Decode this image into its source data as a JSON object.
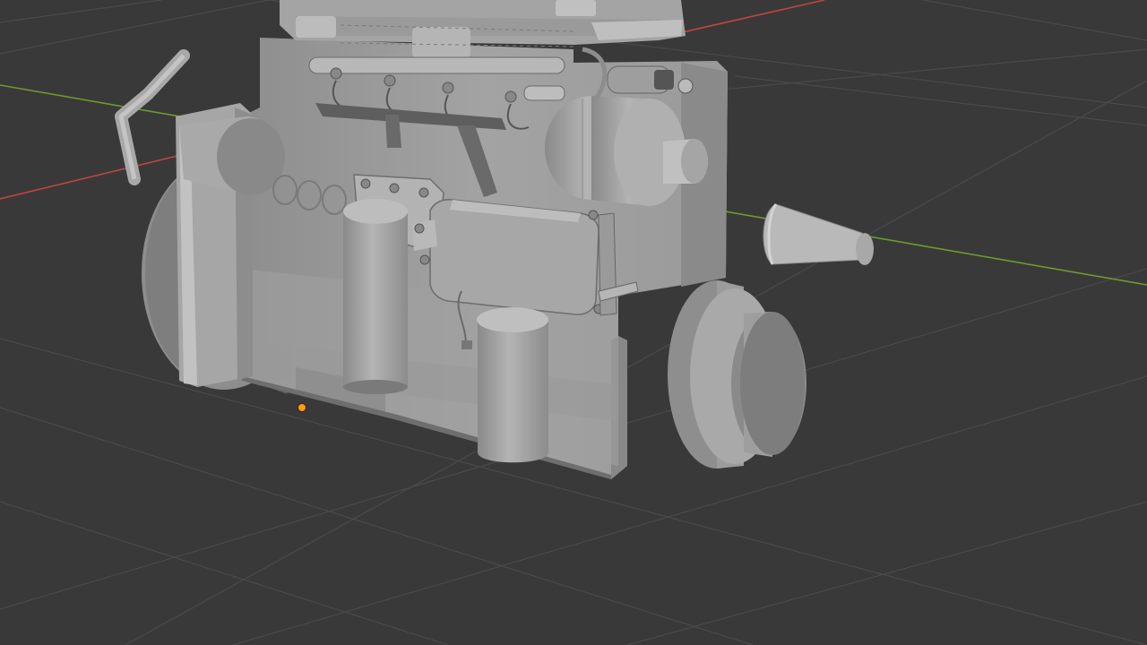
{
  "viewport": {
    "editor": "3D Viewport",
    "shading": "solid",
    "scene_object": "engine-model",
    "axes": {
      "x_axis_color": "#c0453f",
      "y_axis_color": "#6f9a2e"
    },
    "colors": {
      "background": "#393939",
      "grid": "#4a4a4a",
      "model": "#9c9c9c",
      "origin": "#ff9a1a"
    }
  }
}
